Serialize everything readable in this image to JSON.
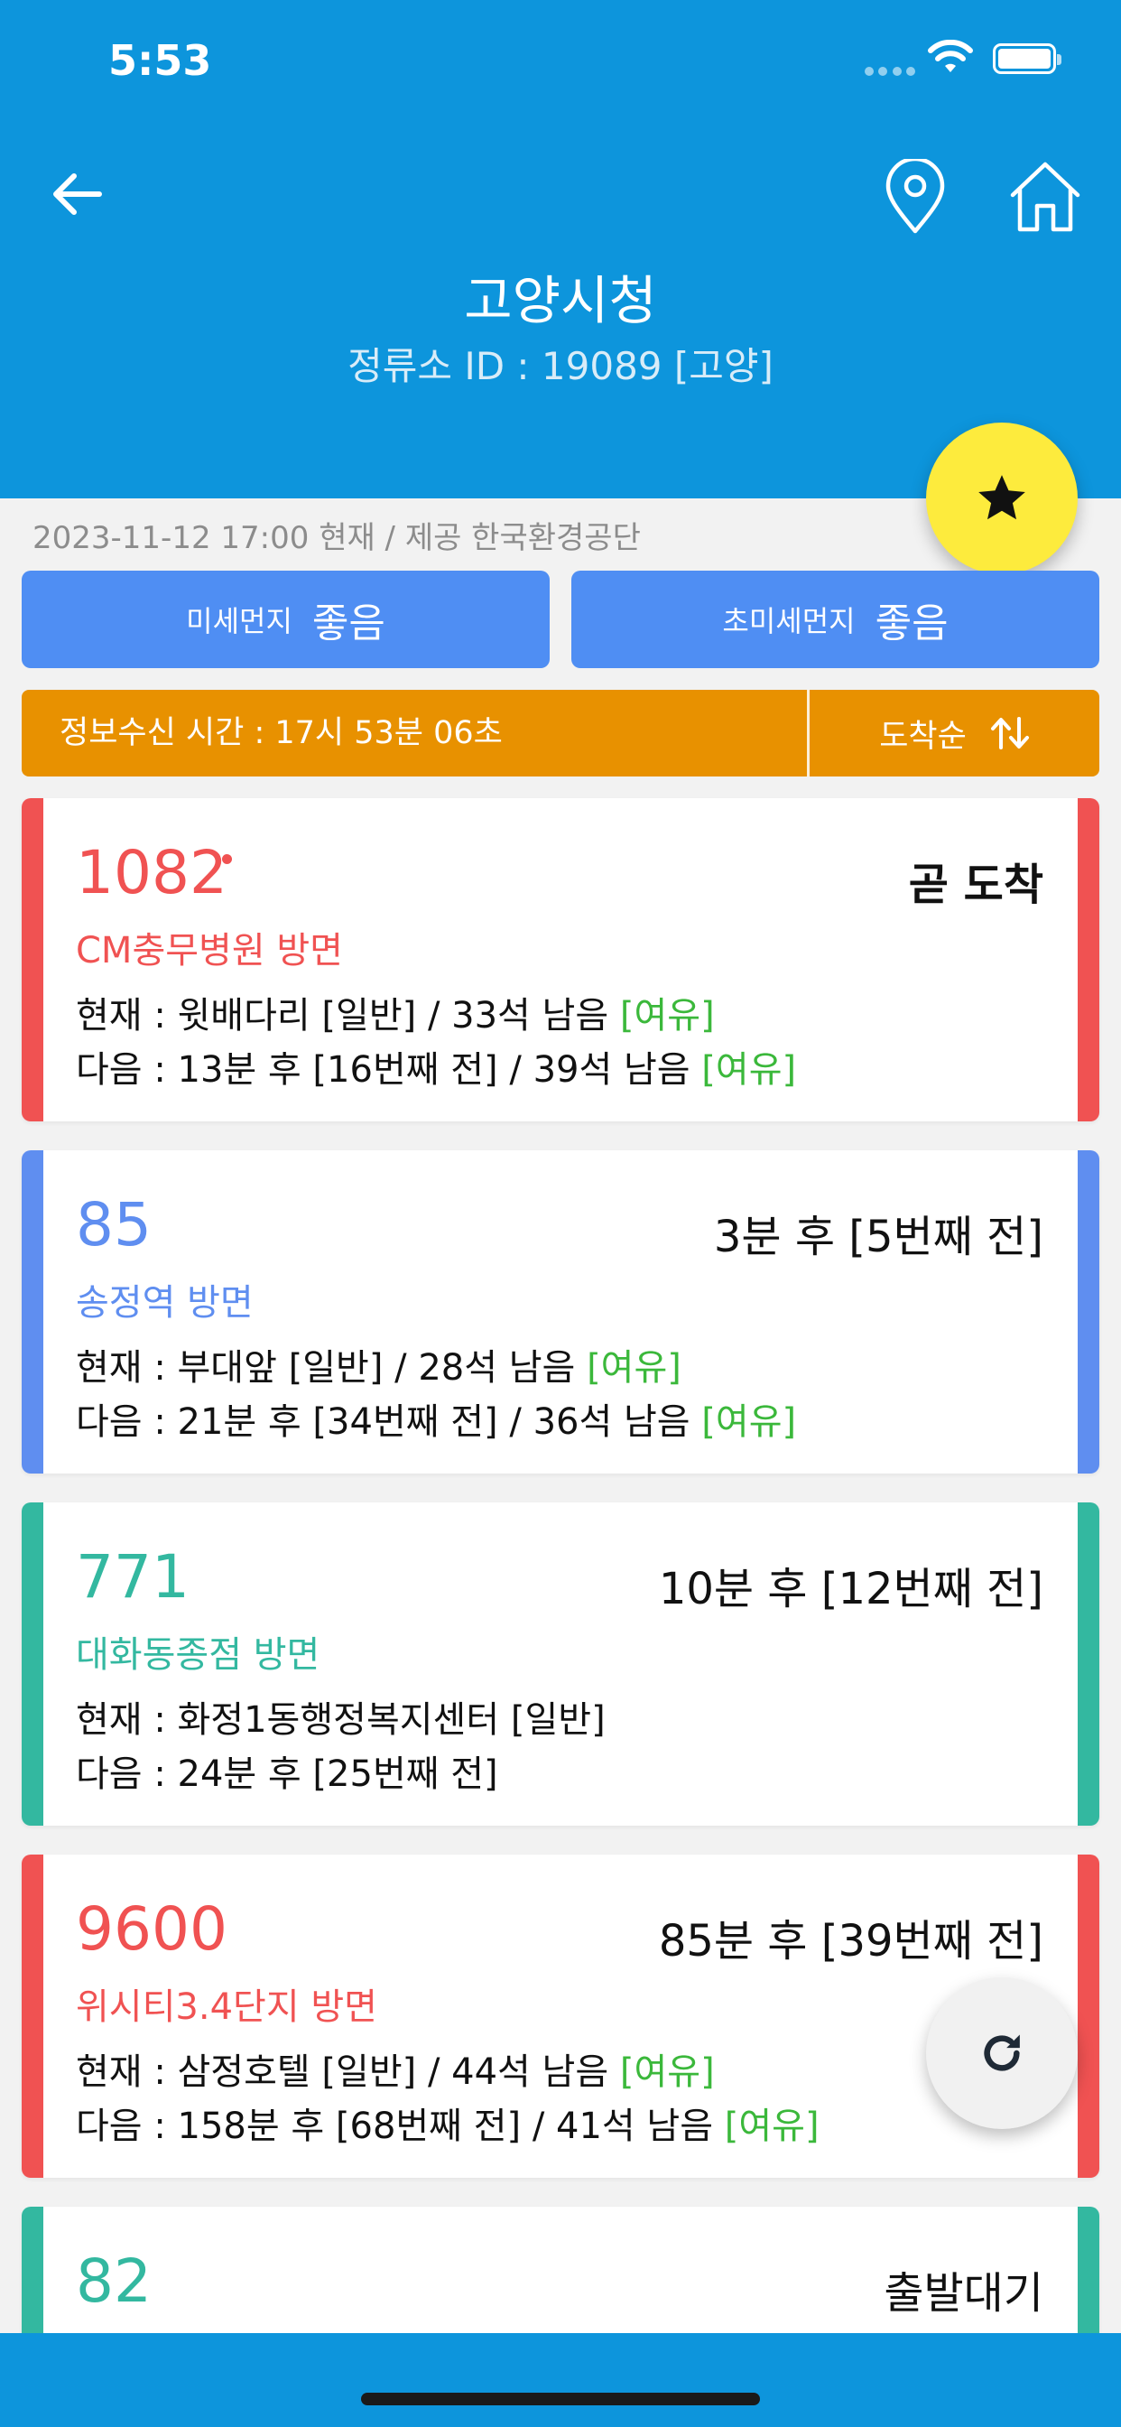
{
  "status_bar": {
    "time": "5:53"
  },
  "header": {
    "title": "고양시청",
    "stop_id": "정류소 ID : 19089 [고양]"
  },
  "update_info": "2023-11-12 17:00 현재 / 제공 한국환경공단",
  "dust": {
    "pm10_label": "미세먼지",
    "pm10_value": "좋음",
    "pm25_label": "초미세먼지",
    "pm25_value": "좋음"
  },
  "info_bar": {
    "received": "정보수신 시간 : 17시 53분 06초",
    "sort_label": "도착순"
  },
  "colors": {
    "header": "#0d95dc",
    "red": "#f05252",
    "blue": "#5f8ef0",
    "teal": "#33b8a0",
    "orange": "#e89100",
    "star_fab": "#fdeb3d"
  },
  "buses": [
    {
      "route": "1082",
      "direction": "CM충무병원 방면",
      "eta": "곧 도착",
      "current": "현재 : 윗배다리 [일반] / 33석 남음 ",
      "current_status": "[여유]",
      "next": "다음 : 13분 후 [16번째 전] / 39석 남음 ",
      "next_status": "[여유]"
    },
    {
      "route": "85",
      "direction": "송정역 방면",
      "eta": "3분 후 [5번째 전]",
      "current": "현재 : 부대앞 [일반] / 28석 남음 ",
      "current_status": "[여유]",
      "next": "다음 : 21분 후 [34번째 전] / 36석 남음 ",
      "next_status": "[여유]"
    },
    {
      "route": "771",
      "direction": "대화동종점 방면",
      "eta": "10분 후 [12번째 전]",
      "current": "현재 : 화정1동행정복지센터 [일반]",
      "next": "다음 : 24분 후 [25번째 전]"
    },
    {
      "route": "9600",
      "direction": "위시티3.4단지 방면",
      "eta": "85분 후 [39번째 전]",
      "current": "현재 : 삼정호텔 [일반] / 44석 남음 ",
      "current_status": "[여유]",
      "next": "다음 : 158분 후 [68번째 전] / 41석 남음 ",
      "next_status": "[여유]"
    },
    {
      "route": "82",
      "eta": "출발대기"
    }
  ],
  "icons": {
    "back": "arrow-left-icon",
    "pin": "map-pin-icon",
    "home": "home-icon",
    "favorite": "star-icon",
    "sort": "sort-arrows-icon",
    "refresh": "refresh-icon"
  }
}
